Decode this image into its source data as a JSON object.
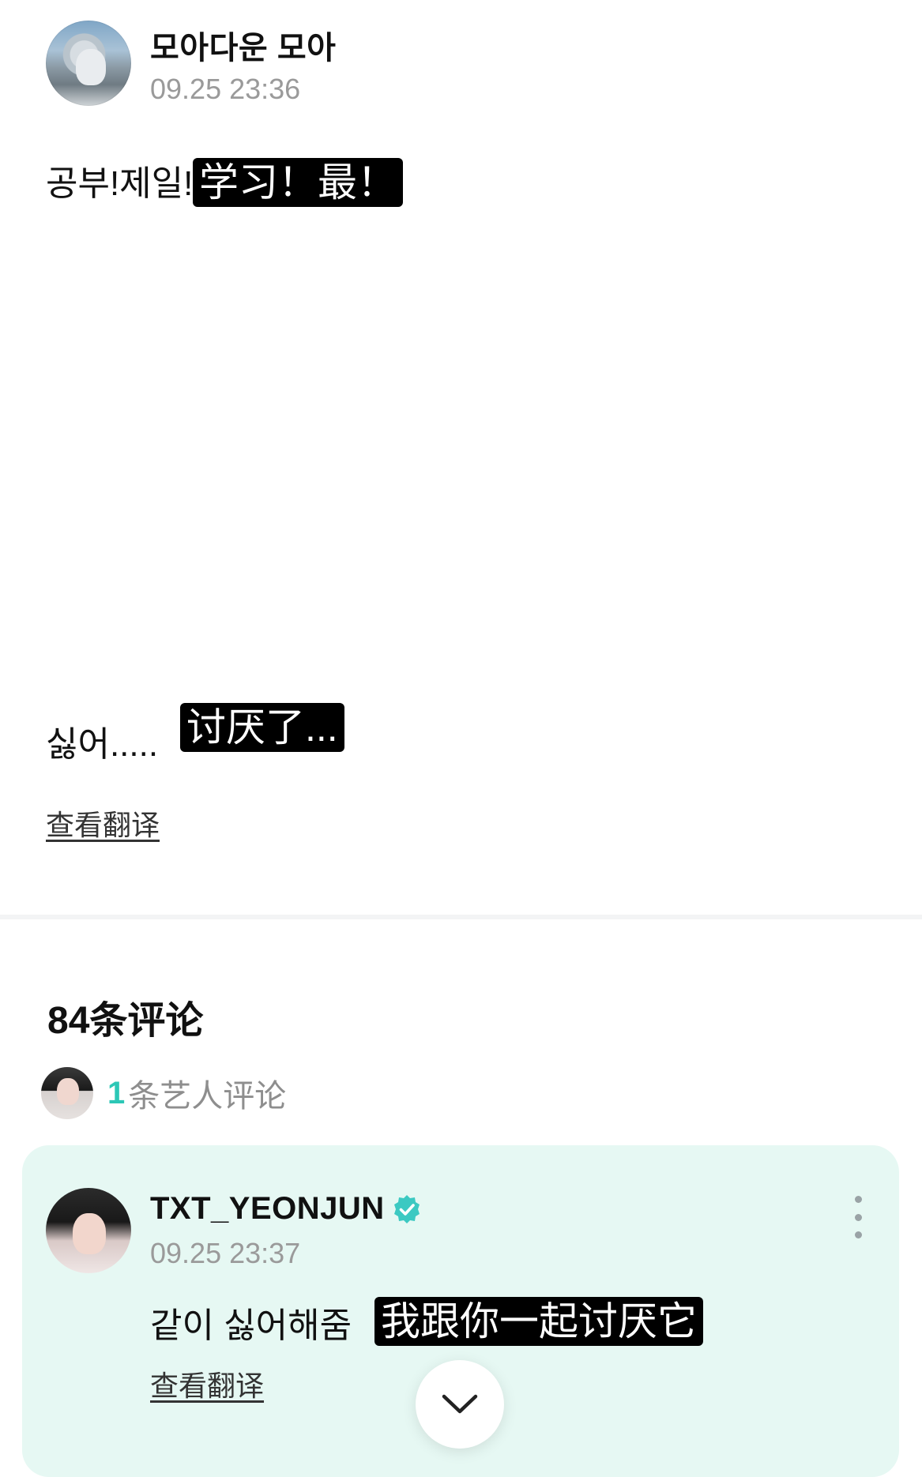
{
  "post": {
    "author": "모아다운 모아",
    "time": "09.25 23:36",
    "line1_text": "공부!제일!",
    "line1_subtitle": "学习！最！",
    "line2_text": "싫어.....",
    "line2_subtitle": "讨厌了...",
    "view_translation": "查看翻译"
  },
  "comments": {
    "count_label": "84条评论",
    "artist_comment_count": "1",
    "artist_comment_label": "条艺人评论",
    "item": {
      "author": "TXT_YEONJUN",
      "time": "09.25 23:37",
      "text": "같이 싫어해줌",
      "subtitle": "我跟你一起讨厌它",
      "view_translation": "查看翻译",
      "verified_icon": "verified-badge-icon",
      "background": "#e6f8f3",
      "accent": "#3cc9c2"
    }
  },
  "accent_color": "#2cc7b6"
}
